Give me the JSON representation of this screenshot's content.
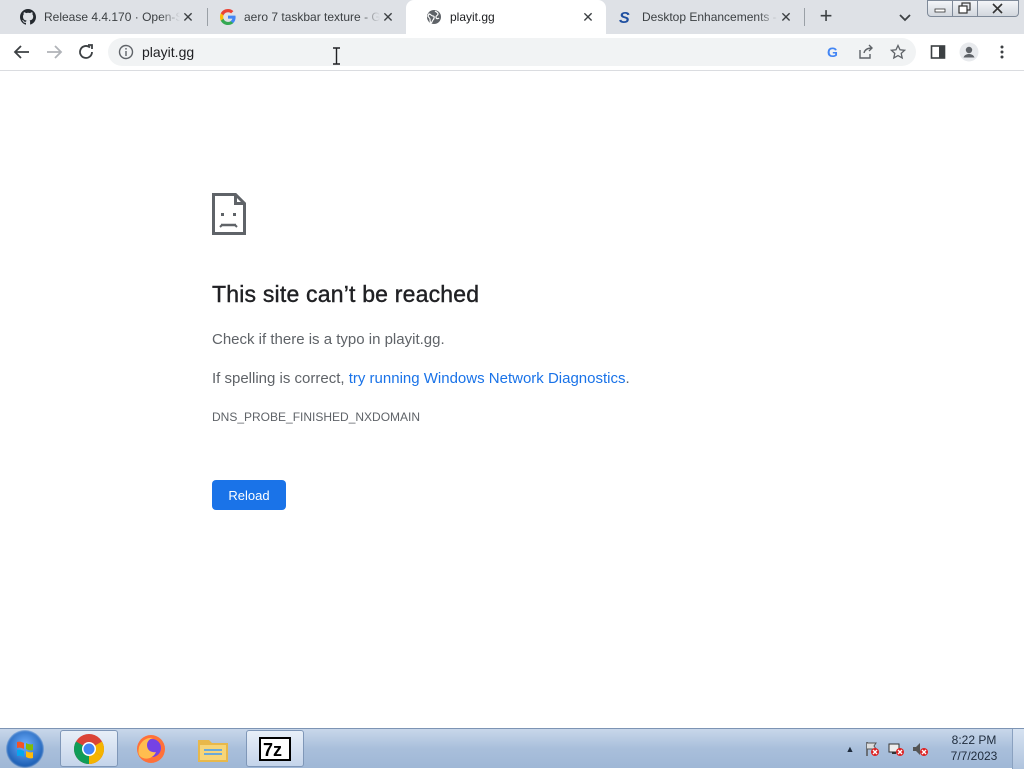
{
  "browser": {
    "tabs": [
      {
        "title": "Release 4.4.170 · Open-St",
        "icon": "github-icon",
        "active": false
      },
      {
        "title": "aero 7 taskbar texture - G",
        "icon": "google-icon",
        "active": false
      },
      {
        "title": "playit.gg",
        "icon": "globe-icon",
        "active": true
      },
      {
        "title": "Desktop Enhancements - ",
        "icon": "stardock-icon",
        "active": false
      }
    ],
    "address": "playit.gg"
  },
  "error_page": {
    "title": "This site can’t be reached",
    "message_prefix": "Check if there is a typo in ",
    "host": "playit.gg",
    "message_suffix": ".",
    "spelling_prefix": "If spelling is correct, ",
    "diagnostics_link": "try running Windows Network Diagnostics",
    "spelling_suffix": ".",
    "error_code": "DNS_PROBE_FINISHED_NXDOMAIN",
    "reload_label": "Reload"
  },
  "taskbar": {
    "apps": [
      "chrome-icon",
      "firefox-icon",
      "file-explorer-icon",
      "7zip-icon"
    ],
    "time": "8:22 PM",
    "date": "7/7/2023"
  },
  "colors": {
    "link": "#1a73e8",
    "button": "#1a73e8",
    "tabstrip": "#dee1e6"
  }
}
